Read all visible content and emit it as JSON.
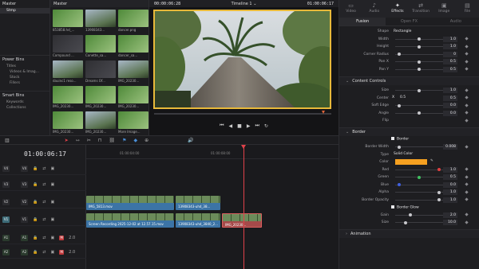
{
  "media_pool": {
    "header": "Master",
    "tree_first": "Stmp",
    "power_bins": "Power Bins",
    "power_items": [
      "Titles",
      "Videos & Imag...",
      "Stock",
      "Fillers"
    ],
    "smart_bins": "Smart Bins",
    "smart_items": [
      "Keywords",
      "Collections"
    ],
    "clips": [
      {
        "name": "853858.hd_...",
        "style": "green"
      },
      {
        "name": "13908343...",
        "style": "sky"
      },
      {
        "name": "dancer.png",
        "style": "green"
      },
      {
        "name": "Compound ...",
        "style": "dark"
      },
      {
        "name": "Conette_sa...",
        "style": "green"
      },
      {
        "name": "dancer_sa...",
        "style": "green"
      },
      {
        "name": "dauinc1 reso...",
        "style": "sky"
      },
      {
        "name": "Dreams Of...",
        "style": "dark"
      },
      {
        "name": "IMG_20230...",
        "style": "sky"
      },
      {
        "name": "IMG_20230...",
        "style": "green"
      },
      {
        "name": "IMG_20230...",
        "style": "green"
      },
      {
        "name": "IMG_20230...",
        "style": "green"
      },
      {
        "name": "IMG_20230...",
        "style": "green"
      },
      {
        "name": "IMG_20230...",
        "style": "sky"
      },
      {
        "name": "More Image...",
        "style": "green"
      }
    ]
  },
  "viewer": {
    "source_tc": "00:00:06:28",
    "timeline_name": "Timeline 1",
    "timeline_tc": "01:00:06:17"
  },
  "inspector": {
    "tabs": [
      {
        "icon": "▭",
        "label": "Video",
        "active": false
      },
      {
        "icon": "♪",
        "label": "Audio",
        "active": false
      },
      {
        "icon": "✦",
        "label": "Effects",
        "active": true
      },
      {
        "icon": "⇄",
        "label": "Transition",
        "active": false
      },
      {
        "icon": "▣",
        "label": "Image",
        "active": false
      },
      {
        "icon": "▤",
        "label": "File",
        "active": false
      }
    ],
    "sub_tabs": [
      {
        "label": "Fusion",
        "active": true
      },
      {
        "label": "Open FX",
        "active": false
      },
      {
        "label": "Audio",
        "active": false
      }
    ],
    "shape_props": [
      {
        "label": "Shape",
        "text": "Rectangle"
      },
      {
        "label": "Width",
        "value": "1.0",
        "knob": 0.5
      },
      {
        "label": "Height",
        "value": "1.0",
        "knob": 0.5
      },
      {
        "label": "Corner Radius",
        "value": "0",
        "knob": 0.05
      },
      {
        "label": "Pan X",
        "value": "0.5",
        "knob": 0.5
      },
      {
        "label": "Pan Y",
        "value": "0.5",
        "knob": 0.5
      }
    ],
    "content_controls_title": "Content Controls",
    "content_props": [
      {
        "label": "Size",
        "value": "1.0",
        "knob": 0.5
      },
      {
        "label": "Center",
        "x_label": "X",
        "x": "0.5",
        "value": "0.5"
      },
      {
        "label": "Soft Edge",
        "value": "0.0",
        "knob": 0.05
      },
      {
        "label": "Angle",
        "value": "0.0",
        "knob": 0.5
      },
      {
        "label": "Flip",
        "value": ""
      }
    ],
    "border_title": "Border",
    "border_enabled_label": "Border",
    "border_props": [
      {
        "label": "Border Width",
        "value": "0.008",
        "knob": 0.05
      },
      {
        "label": "Type",
        "text": "Solid Color"
      },
      {
        "label": "Color",
        "swatch": "#f5a020"
      },
      {
        "label": "Red",
        "value": "1.0",
        "knob": 0.95,
        "knob_color": "#e04040"
      },
      {
        "label": "Green",
        "value": "0.5",
        "knob": 0.5,
        "knob_color": "#40c060"
      },
      {
        "label": "Blue",
        "value": "0.0",
        "knob": 0.05,
        "knob_color": "#4060e0"
      },
      {
        "label": "Alpha",
        "value": "1.0",
        "knob": 0.95
      },
      {
        "label": "Border Opacity",
        "value": "1.0",
        "knob": 0.95
      }
    ],
    "border_glow_label": "Border Glow",
    "glow_props": [
      {
        "label": "Gain",
        "value": "2.0",
        "knob": 0.3
      },
      {
        "label": "Size",
        "value": "10.0",
        "knob": 0.2
      }
    ],
    "animation_title": "Animation"
  },
  "timeline": {
    "current_tc": "01:00:06:17",
    "ruler_marks": [
      "01:00:00:00",
      "01:00:04:00",
      "01:00:08:00"
    ],
    "tracks": [
      {
        "id": "V4",
        "kind": "video",
        "num": "V4"
      },
      {
        "id": "V3",
        "kind": "video",
        "num": "V3"
      },
      {
        "id": "V2",
        "kind": "video",
        "num": "V2"
      },
      {
        "id": "V1",
        "kind": "video",
        "num": "V1"
      },
      {
        "id": "A1",
        "kind": "audio",
        "num": "A1",
        "level": "2.0"
      },
      {
        "id": "A2",
        "kind": "audio",
        "num": "A2",
        "level": "2.0"
      }
    ],
    "clips_v2": [
      {
        "label": "IMG_5813.mov"
      },
      {
        "label": "13908343-uhd_38..."
      }
    ],
    "clips_v1": [
      {
        "label": "Screen Recording 2025-12-02 at 12.57.15.mov"
      },
      {
        "label": "13908343-uhd_3840_2..."
      },
      {
        "label": "IMG_20230..."
      }
    ]
  }
}
